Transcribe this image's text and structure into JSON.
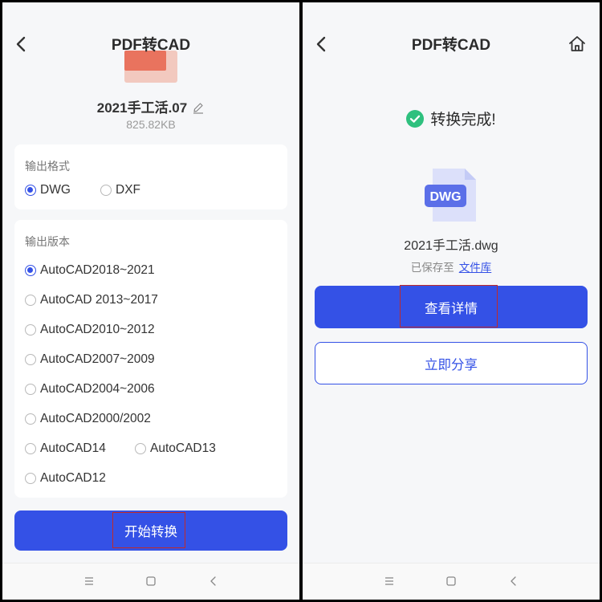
{
  "left": {
    "title": "PDF转CAD",
    "file": {
      "name": "2021手工活.07",
      "size": "825.82KB"
    },
    "output_format": {
      "label": "输出格式",
      "options": [
        "DWG",
        "DXF"
      ],
      "selected": "DWG"
    },
    "output_version": {
      "label": "输出版本",
      "options": [
        "AutoCAD2018~2021",
        "AutoCAD 2013~2017",
        "AutoCAD2010~2012",
        "AutoCAD2007~2009",
        "AutoCAD2004~2006",
        "AutoCAD2000/2002",
        "AutoCAD14",
        "AutoCAD13",
        "AutoCAD12"
      ],
      "selected": "AutoCAD2018~2021"
    },
    "start_button": "开始转换"
  },
  "right": {
    "title": "PDF转CAD",
    "status": "转换完成!",
    "file_badge": "DWG",
    "file_name": "2021手工活.dwg",
    "saved_prefix": "已保存至",
    "saved_link": "文件库",
    "view_details": "查看详情",
    "share": "立即分享"
  },
  "icons": {
    "back": "chevron-left",
    "home": "house",
    "edit": "pencil",
    "success": "check-circle",
    "file": "dwg-document",
    "system_nav": [
      "menu",
      "home-square",
      "back"
    ]
  },
  "colors": {
    "primary": "#3451E6",
    "success": "#2EC07E",
    "file_icon": "#5B6FE8",
    "highlight": "#C02A2A",
    "background": "#F6F7F9"
  }
}
